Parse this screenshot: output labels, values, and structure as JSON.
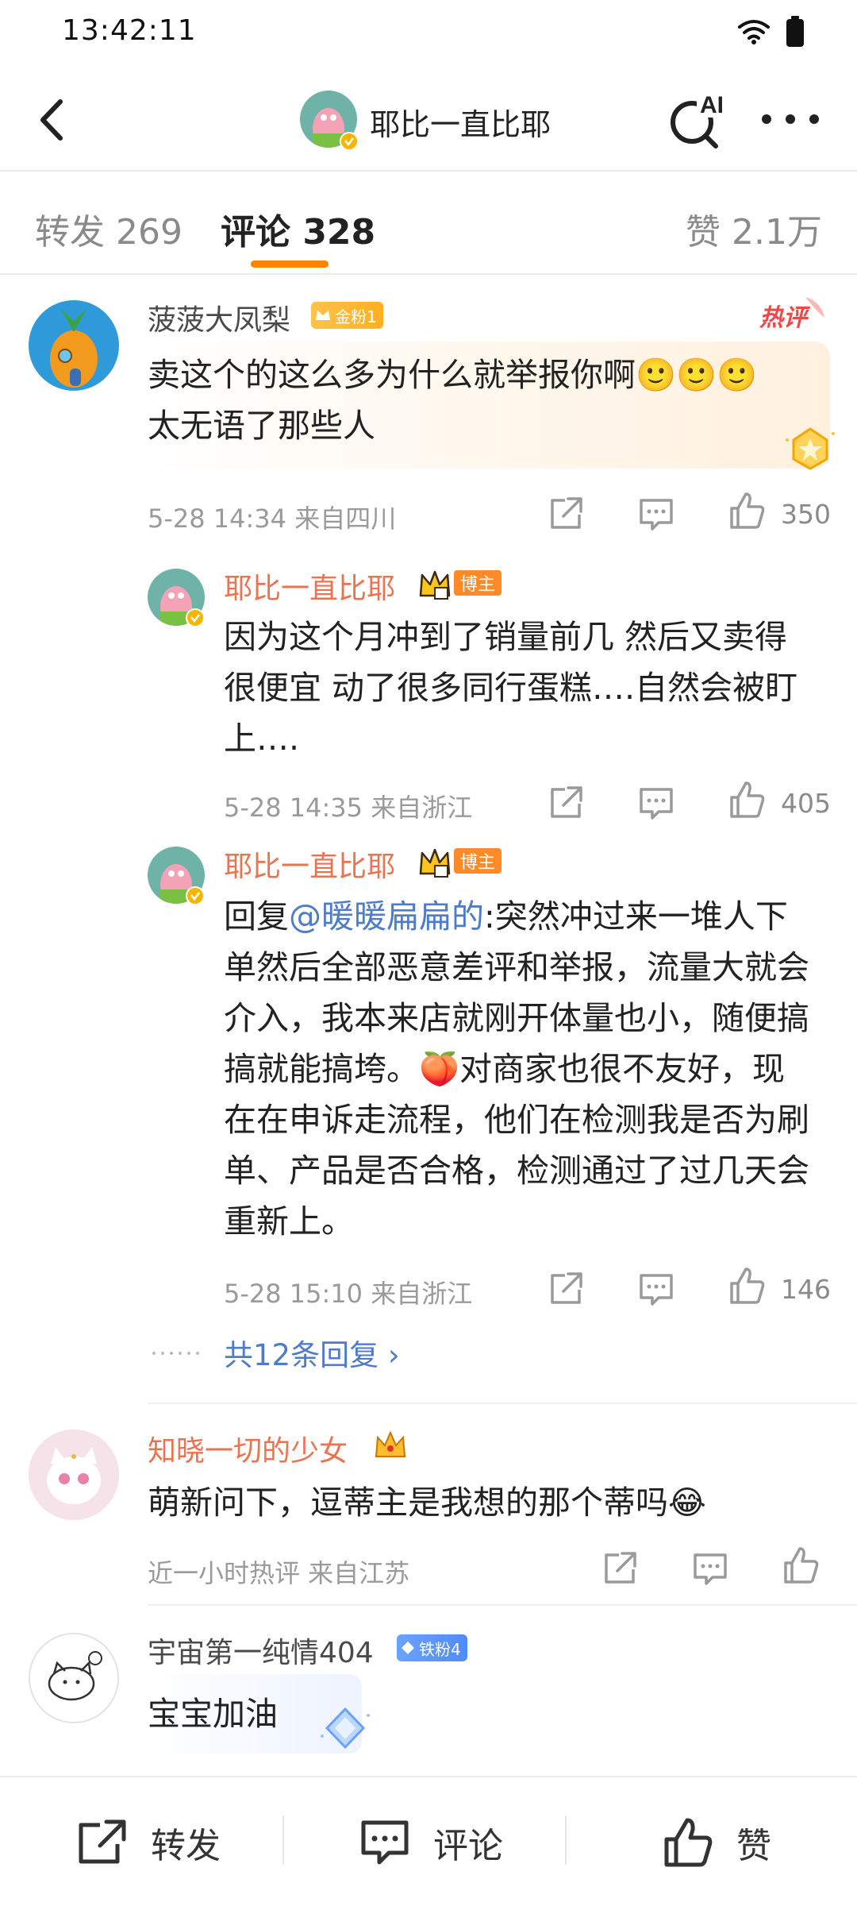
{
  "status_bar": {
    "time": "13:42:11"
  },
  "header": {
    "title": "耶比一直比耶",
    "ai_label": "AI"
  },
  "tabs": [
    {
      "label": "转发 269"
    },
    {
      "label": "评论 328"
    },
    {
      "label": "赞 2.1万"
    }
  ],
  "hot_tag": "热评",
  "comments": [
    {
      "user": "菠菠大凤梨",
      "badge": "金粉1",
      "text_line1": "卖这个的这么多为什么就举报你啊🙂🙂🙂",
      "text_line2": "太无语了那些人",
      "meta": "5-28 14:34  来自四川",
      "likes": "350",
      "replies": [
        {
          "user": "耶比一直比耶",
          "badge": "博主",
          "text": "因为这个月冲到了销量前几 然后又卖得很便宜 动了很多同行蛋糕….自然会被盯上….",
          "meta": "5-28 14:35  来自浙江",
          "likes": "405"
        },
        {
          "user": "耶比一直比耶",
          "badge": "博主",
          "reply_prefix": "回复",
          "mention": "@暖暖扁扁的",
          "text": ":突然冲过来一堆人下单然后全部恶意差评和举报，流量大就会介入，我本来店就刚开体量也小，随便搞搞就能搞垮。🍑对商家也很不友好，现在在申诉走流程，他们在检测我是否为刷单、产品是否合格，检测通过了过几天会重新上。",
          "meta": "5-28 15:10  来自浙江",
          "likes": "146"
        }
      ],
      "more_replies": "共12条回复 ›"
    },
    {
      "user": "知晓一切的少女",
      "text": "萌新问下，逗蒂主是我想的那个蒂吗😂",
      "meta": "近一小时热评  来自江苏"
    },
    {
      "user": "宇宙第一纯情404",
      "badge": "铁粉4",
      "text": "宝宝加油"
    }
  ],
  "bottom_bar": {
    "repost": "转发",
    "comment": "评论",
    "like": "赞"
  },
  "colors": {
    "accent": "#ff8200",
    "link": "#4f7cc9",
    "host_name": "#eb7350"
  }
}
